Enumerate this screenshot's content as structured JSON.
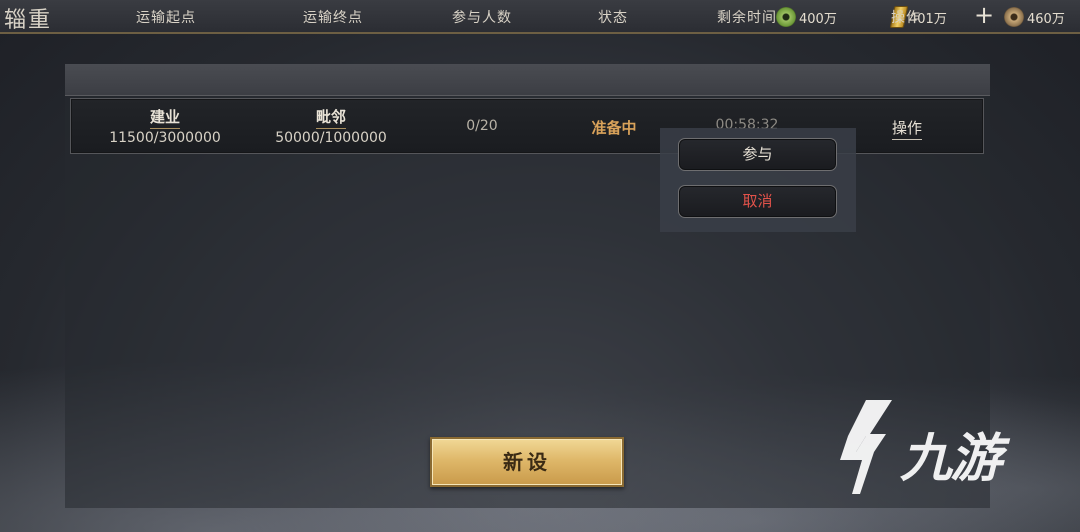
{
  "header": {
    "title": "辎重",
    "currencies": [
      {
        "icon": "jade-coin-icon",
        "value": "400万"
      },
      {
        "icon": "gold-ingot-icon",
        "value": "401万"
      },
      {
        "icon": "copper-coin-icon",
        "value": "460万"
      }
    ],
    "add_label": "+"
  },
  "table": {
    "columns": [
      "运输起点",
      "运输终点",
      "参与人数",
      "状态",
      "剩余时间",
      "操作"
    ],
    "rows": [
      {
        "origin": "建业",
        "origin_capacity": "11500/3000000",
        "destination": "毗邻",
        "destination_capacity": "50000/1000000",
        "participants": "0/20",
        "status": "准备中",
        "remaining": "00:58:32",
        "action": "操作"
      }
    ]
  },
  "popup_menu": {
    "join_label": "参与",
    "cancel_label": "取消"
  },
  "new_button_label": "新设",
  "watermark": "九游",
  "colors": {
    "status": "#d9a25a",
    "cancel": "#e2524a",
    "button_gold": "#dfb86a"
  }
}
